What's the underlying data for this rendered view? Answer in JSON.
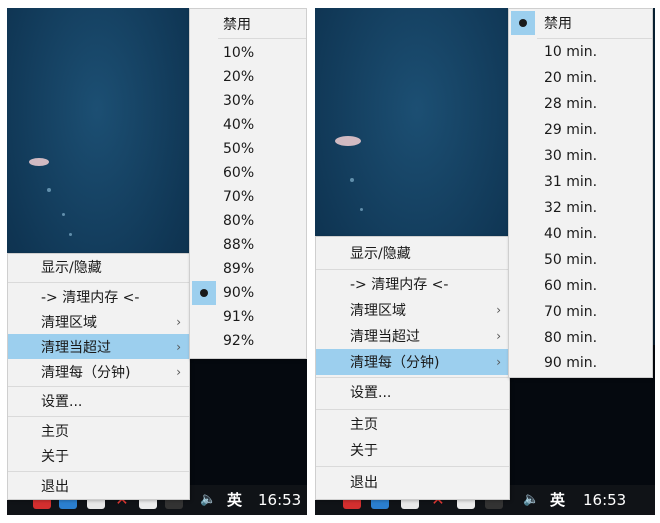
{
  "left": {
    "context_menu": [
      {
        "label": "显示/隐藏"
      },
      {
        "label": "-> 清理内存 <-"
      },
      {
        "label": "清理区域",
        "submenu": true
      },
      {
        "label": "清理当超过",
        "submenu": true,
        "active": true
      },
      {
        "label": "清理每（分钟)",
        "submenu": true
      },
      {
        "label": "设置..."
      },
      {
        "label": "主页"
      },
      {
        "label": "关于"
      },
      {
        "label": "退出"
      }
    ],
    "submenu": [
      "禁用",
      "10%",
      "20%",
      "30%",
      "40%",
      "50%",
      "60%",
      "70%",
      "80%",
      "88%",
      "89%",
      "90%",
      "91%",
      "92%"
    ],
    "selected_index": 11,
    "taskbar": {
      "ime": "英",
      "time": "16:53"
    }
  },
  "right": {
    "context_menu": [
      {
        "label": "显示/隐藏"
      },
      {
        "label": "-> 清理内存 <-"
      },
      {
        "label": "清理区域",
        "submenu": true
      },
      {
        "label": "清理当超过",
        "submenu": true
      },
      {
        "label": "清理每（分钟)",
        "submenu": true,
        "active": true
      },
      {
        "label": "设置..."
      },
      {
        "label": "主页"
      },
      {
        "label": "关于"
      },
      {
        "label": "退出"
      }
    ],
    "submenu": [
      "禁用",
      "10 min.",
      "20 min.",
      "28 min.",
      "29 min.",
      "30 min.",
      "31 min.",
      "32 min.",
      "40 min.",
      "50 min.",
      "60 min.",
      "70 min.",
      "80 min.",
      "90 min."
    ],
    "selected_index": 0,
    "taskbar": {
      "ime": "英",
      "time": "16:53"
    }
  },
  "icons": [
    "volume-icon",
    "app-icon-red",
    "app-icon-blue",
    "app-icon-x"
  ]
}
